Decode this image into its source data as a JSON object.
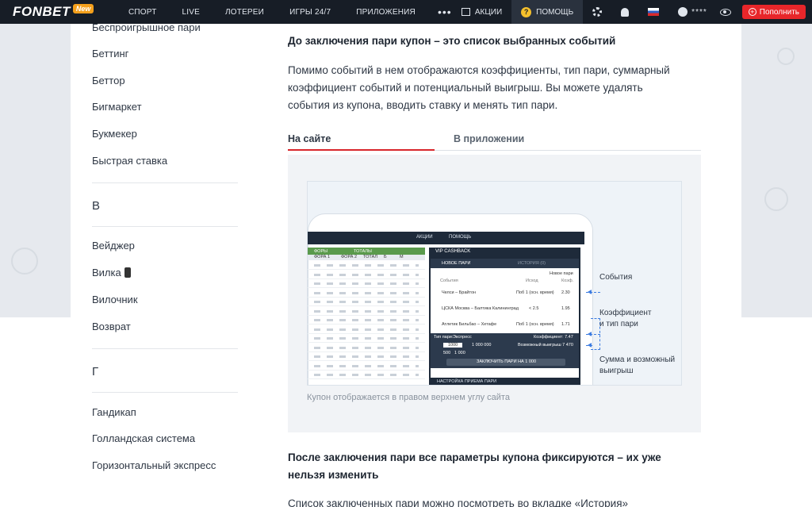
{
  "header": {
    "logo": "FONBET",
    "logo_badge": "New",
    "nav": [
      "СПОРТ",
      "LIVE",
      "ЛОТЕРЕИ",
      "ИГРЫ 24/7",
      "ПРИЛОЖЕНИЯ"
    ],
    "more": "•••",
    "promotions": "АКЦИИ",
    "help": "ПОМОЩЬ",
    "balance_mask": "****",
    "deposit": "Пополнить"
  },
  "sidebar": {
    "items_top": [
      "Беспроигрышное пари",
      "Беттинг",
      "Беттор",
      "Бигмаркет",
      "Букмекер",
      "Быстрая ставка"
    ],
    "letter_v": "В",
    "items_v": [
      "Вейджер",
      "Вилка",
      "Вилочник",
      "Возврат"
    ],
    "letter_g": "Г",
    "items_g": [
      "Гандикап",
      "Голландская система",
      "Горизонтальный экспресс"
    ]
  },
  "article": {
    "heading1": "До заключения пари купон – это список выбранных событий",
    "para1_l1": "Помимо событий в нем отображаются коэффициенты, тип пари, суммарный",
    "para1_l2": "коэффициент событий и потенциальный выигрыш. Вы можете удалять",
    "para1_l3": "события из купона, вводить ставку и менять тип пари.",
    "tabs": [
      "На сайте",
      "В приложении"
    ],
    "caption": "Купон отображается в правом верхнем углу сайта",
    "heading2_l1": "После заключения пари все параметры купона фиксируются – их уже",
    "heading2_l2": "нельзя изменить",
    "para2": "Список заключенных пари можно посмотреть во вкладке «История»"
  },
  "figure": {
    "annotations": [
      "События",
      "Коэффициент",
      "и тип пари",
      "Сумма и возможный",
      "выигрыш"
    ],
    "mock": {
      "bar": [
        "АКЦИИ",
        "ПОМОЩЬ"
      ],
      "col_head": [
        "ФОРЫ",
        "ТОТАЛЫ"
      ],
      "col_sub": [
        "ФОРА 1",
        "ФОРА 2",
        "ТОТАЛ",
        "Б",
        "М"
      ],
      "coupon_title": "VIP CASHBACK",
      "coupon_tabs": [
        "НОВОЕ ПАРИ",
        "ИСТОРИЯ (0)"
      ],
      "coupon_new": "Новое пари",
      "coupon_cols": [
        "События",
        "Исход",
        "Коэф."
      ],
      "events": [
        {
          "name": "Челси – Брайтон",
          "outcome": "Поб 1 (осн. время)",
          "odd": "2.30"
        },
        {
          "name": "ЦСКА Москва – Балтика Калининград",
          "outcome": "< 2.5",
          "odd": "1.95"
        },
        {
          "name": "Атлетик Бильбао – Хетафе",
          "outcome": "Поб 1 (осн. время)",
          "odd": "1.71"
        }
      ],
      "bet_type_label": "Тип пари:",
      "bet_type": "Экспресс",
      "coef": "Коэффициент: 7.47",
      "stake": "1000",
      "max": "1 000 000",
      "win": "Возможный выигрыш 7 470",
      "quick": [
        "500",
        "1 000"
      ],
      "place_btn": "ЗАКЛЮЧИТЬ ПАРИ НА 1 000",
      "settings": "НАСТРОЙКА ПРИЕМА ПАРИ"
    }
  }
}
